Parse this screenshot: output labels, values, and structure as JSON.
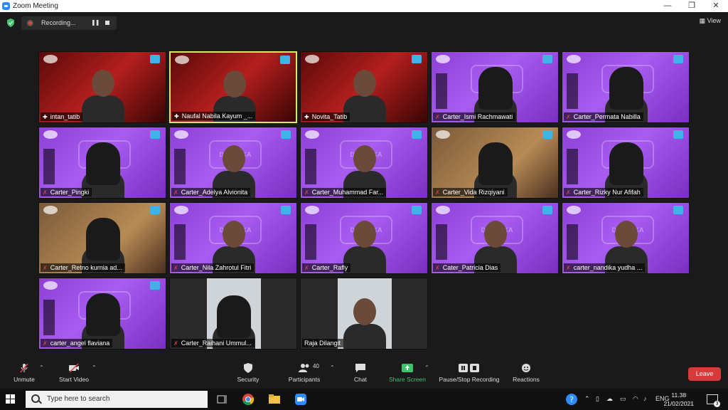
{
  "window": {
    "title": "Zoom Meeting",
    "controls": [
      "—",
      "❐",
      "✕"
    ]
  },
  "recording": {
    "status": "Recording...",
    "pause_glyph": "❚❚"
  },
  "view_label": "View",
  "colors": {
    "active_border": "#d8e66b",
    "leave": "#d63b3b",
    "share": "#3cc46b",
    "mute": "#e04141"
  },
  "participants": [
    {
      "name": "intan_tatib",
      "pinned": true,
      "muted": false,
      "bg": "red",
      "veil": false
    },
    {
      "name": "Naufal Nabila Kayum _...",
      "pinned": true,
      "muted": false,
      "bg": "red",
      "veil": false,
      "active": true
    },
    {
      "name": "Novita_Tatib",
      "pinned": true,
      "muted": false,
      "bg": "red",
      "veil": false
    },
    {
      "name": "Carter_Ismi Rachmawati",
      "pinned": false,
      "muted": true,
      "bg": "purple",
      "veil": true
    },
    {
      "name": "Carter_Permata Nabilla",
      "pinned": false,
      "muted": true,
      "bg": "purple",
      "veil": true
    },
    {
      "name": "Carter_Pingki",
      "pinned": false,
      "muted": true,
      "bg": "purple",
      "veil": true
    },
    {
      "name": "Carter_Adelya Alvionita",
      "pinned": false,
      "muted": true,
      "bg": "purple",
      "veil": false
    },
    {
      "name": "Carter_Muhammad Far...",
      "pinned": false,
      "muted": true,
      "bg": "purple",
      "veil": false
    },
    {
      "name": "Carter_Vida Rizqiyani",
      "pinned": false,
      "muted": true,
      "bg": "room",
      "veil": true
    },
    {
      "name": "Carter_Rizky Nur Afifah",
      "pinned": false,
      "muted": true,
      "bg": "purple",
      "veil": true
    },
    {
      "name": "Carter_Retno kurnia ad...",
      "pinned": false,
      "muted": true,
      "bg": "room",
      "veil": true
    },
    {
      "name": "Carter_Nila Zahrotul Fitri",
      "pinned": false,
      "muted": true,
      "bg": "purple",
      "veil": false
    },
    {
      "name": "Carter_Rafly",
      "pinned": false,
      "muted": true,
      "bg": "purple",
      "veil": false
    },
    {
      "name": "Cater_Patricia Dias",
      "pinned": false,
      "muted": true,
      "bg": "purple",
      "veil": false
    },
    {
      "name": "carter_nandika yudha ...",
      "pinned": false,
      "muted": true,
      "bg": "purple",
      "veil": false
    },
    {
      "name": "carter_angel flaviana",
      "pinned": false,
      "muted": true,
      "bg": "purple",
      "veil": true
    },
    {
      "name": "Carter_Raihani Ummul...",
      "pinned": false,
      "muted": true,
      "bg": "photo",
      "veil": true
    },
    {
      "name": "Raja Dilangit",
      "pinned": false,
      "muted": false,
      "bg": "photo",
      "veil": false
    }
  ],
  "watermark": "DINAMIKA",
  "toolbar": {
    "unmute": "Unmute",
    "start_video": "Start Video",
    "security": "Security",
    "participants": "Participants",
    "participants_count": "40",
    "chat": "Chat",
    "share_screen": "Share Screen",
    "pause_stop_recording": "Pause/Stop Recording",
    "reactions": "Reactions",
    "leave": "Leave"
  },
  "taskbar": {
    "search_placeholder": "Type here to search",
    "language": "ENG",
    "time": "11.38",
    "date": "21/02/2021",
    "notification_count": "3"
  }
}
